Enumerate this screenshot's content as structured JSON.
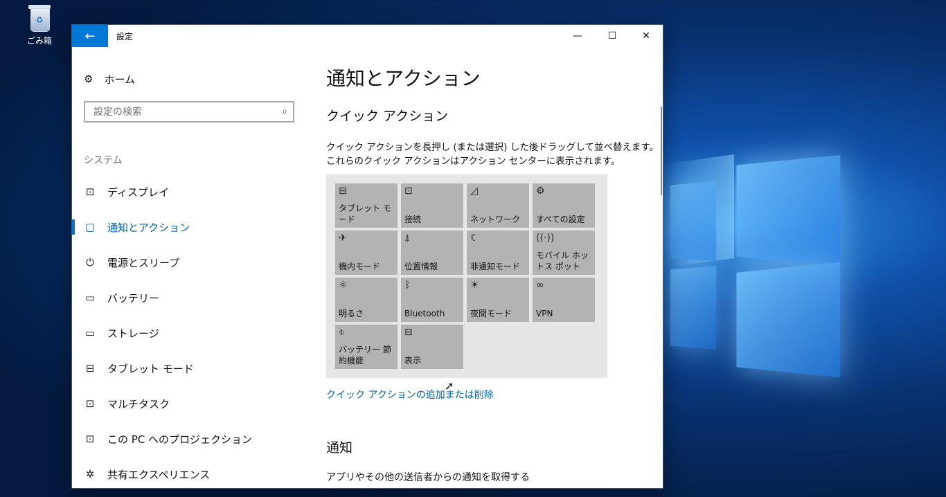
{
  "desktop": {
    "recycle_bin_label": "ごみ箱"
  },
  "window": {
    "title": "設定",
    "back_icon": "arrow-left-icon",
    "controls": {
      "minimize": "—",
      "maximize": "☐",
      "close": "✕"
    }
  },
  "sidebar": {
    "home_label": "ホーム",
    "search_placeholder": "設定の検索",
    "section_label": "システム",
    "items": [
      {
        "label": "ディスプレイ",
        "icon": "⊡"
      },
      {
        "label": "通知とアクション",
        "icon": "▢"
      },
      {
        "label": "電源とスリープ",
        "icon": "⏻"
      },
      {
        "label": "バッテリー",
        "icon": "▭"
      },
      {
        "label": "ストレージ",
        "icon": "▭"
      },
      {
        "label": "タブレット モード",
        "icon": "⊟"
      },
      {
        "label": "マルチタスク",
        "icon": "⊡"
      },
      {
        "label": "この PC へのプロジェクション",
        "icon": "⊡"
      },
      {
        "label": "共有エクスペリエンス",
        "icon": "✲"
      }
    ]
  },
  "content": {
    "page_title": "通知とアクション",
    "quick_actions_title": "クイック アクション",
    "quick_actions_desc_line1": "クイック アクションを長押し (または選択) した後ドラッグして並べ替えます。",
    "quick_actions_desc_line2": "これらのクイック アクションはアクション センターに表示されます。",
    "tiles": [
      {
        "label": "タブレット モード",
        "icon": "⊟"
      },
      {
        "label": "接続",
        "icon": "⊡"
      },
      {
        "label": "ネットワーク",
        "icon": "◿"
      },
      {
        "label": "すべての設定",
        "icon": "⚙"
      },
      {
        "label": "機内モード",
        "icon": "✈"
      },
      {
        "label": "位置情報",
        "icon": "⍋"
      },
      {
        "label": "非通知モード",
        "icon": "☾"
      },
      {
        "label": "モバイル ホットス ポット",
        "icon": "((·))"
      },
      {
        "label": "明るさ",
        "icon": "☼"
      },
      {
        "label": "Bluetooth",
        "icon": "ᛒ"
      },
      {
        "label": "夜間モード",
        "icon": "☀"
      },
      {
        "label": "VPN",
        "icon": "∞"
      },
      {
        "label": "バッテリー 節約機能",
        "icon": "⌽"
      },
      {
        "label": "表示",
        "icon": "⊟"
      }
    ],
    "add_remove_link": "クイック アクションの追加または削除",
    "notifications_title": "通知",
    "notifications_desc": "アプリやその他の送信者からの通知を取得する"
  }
}
